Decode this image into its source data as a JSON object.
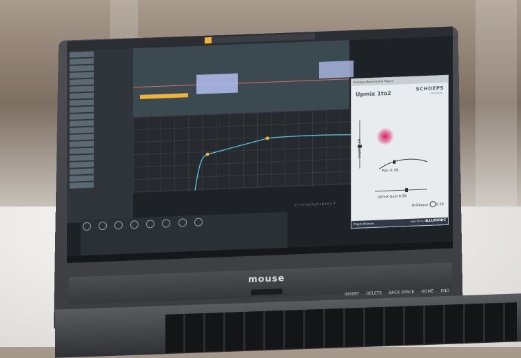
{
  "laptop": {
    "brand_logo": "mouse"
  },
  "screen": {
    "plugin": {
      "titlebar": "Schoeps Mono Upmix Plug-in",
      "name": "Upmix 1to2",
      "brand": "SCHOEPS",
      "brand_sub": "Mikrofone",
      "depth_label": "Depth 0.59",
      "pan_label": "Pan -0.39",
      "gain_label": "Upmix Gain  0.58",
      "brilliance_label": "Brilliance",
      "brilliance_value": "0.20",
      "footer_left": "Plugin Alliance",
      "footer_algo": "Algorithms by",
      "footer_right": "ILLUSONIC"
    },
    "status_text": "オーディオエフェクトをドロップ",
    "colors": {
      "accent": "#f2b33a",
      "clip": "#aeb8e6",
      "curve": "#4fc3d9",
      "sound_source": "#d6225f"
    }
  },
  "keyboard": {
    "labels": [
      "INSERT",
      "DELETE",
      "BACK SPACE",
      "HOME",
      "END"
    ]
  }
}
